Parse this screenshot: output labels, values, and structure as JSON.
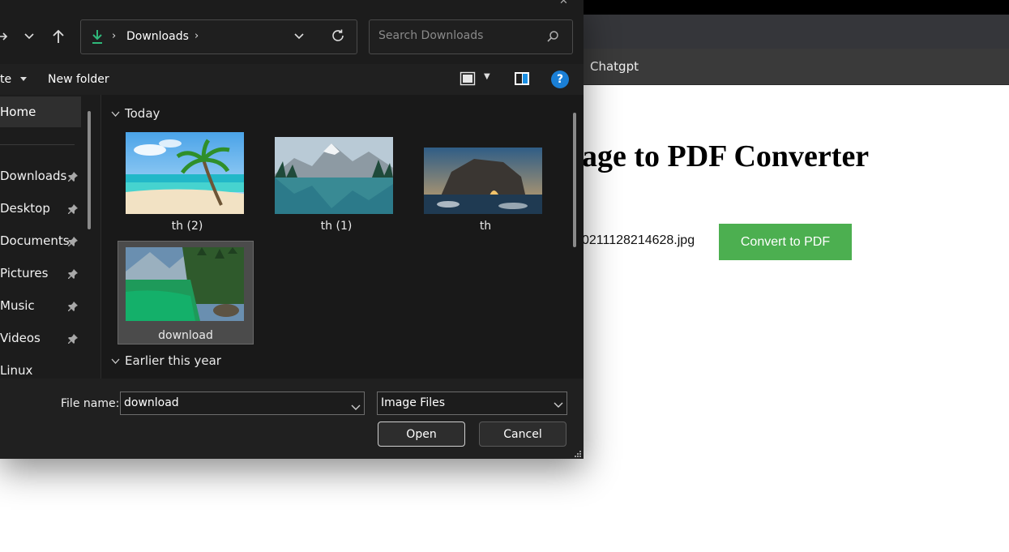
{
  "browser": {
    "bookmark": "Chatgpt",
    "page": {
      "title": "age to PDF Converter",
      "file_name": "0211128214628.jpg",
      "convert_button": "Convert to PDF"
    }
  },
  "dialog": {
    "address": {
      "icon": "download-arrow-icon",
      "location": "Downloads"
    },
    "search": {
      "placeholder": "Search Downloads"
    },
    "commands": {
      "organize": "te",
      "new_folder": "New folder",
      "help": "?"
    },
    "sidebar": {
      "home": "Home",
      "items": [
        {
          "label": "Downloads",
          "pinned": true
        },
        {
          "label": "Desktop",
          "pinned": true
        },
        {
          "label": "Documents",
          "pinned": true
        },
        {
          "label": "Pictures",
          "pinned": true
        },
        {
          "label": "Music",
          "pinned": true
        },
        {
          "label": "Videos",
          "pinned": true
        },
        {
          "label": "Linux",
          "pinned": false
        }
      ]
    },
    "groups": [
      {
        "label": "Today",
        "files": [
          {
            "name": "th (2)",
            "image": "palm tree beach"
          },
          {
            "name": "th (1)",
            "image": "mountain lake reflection"
          },
          {
            "name": "th",
            "image": "rock arch at sunset"
          },
          {
            "name": "download",
            "image": "green alpine lake",
            "selected": true
          }
        ]
      },
      {
        "label": "Earlier this year",
        "files": []
      }
    ],
    "footer": {
      "file_name_label": "File name:",
      "file_name_value": "download",
      "file_type": "Image Files",
      "open": "Open",
      "cancel": "Cancel"
    }
  }
}
